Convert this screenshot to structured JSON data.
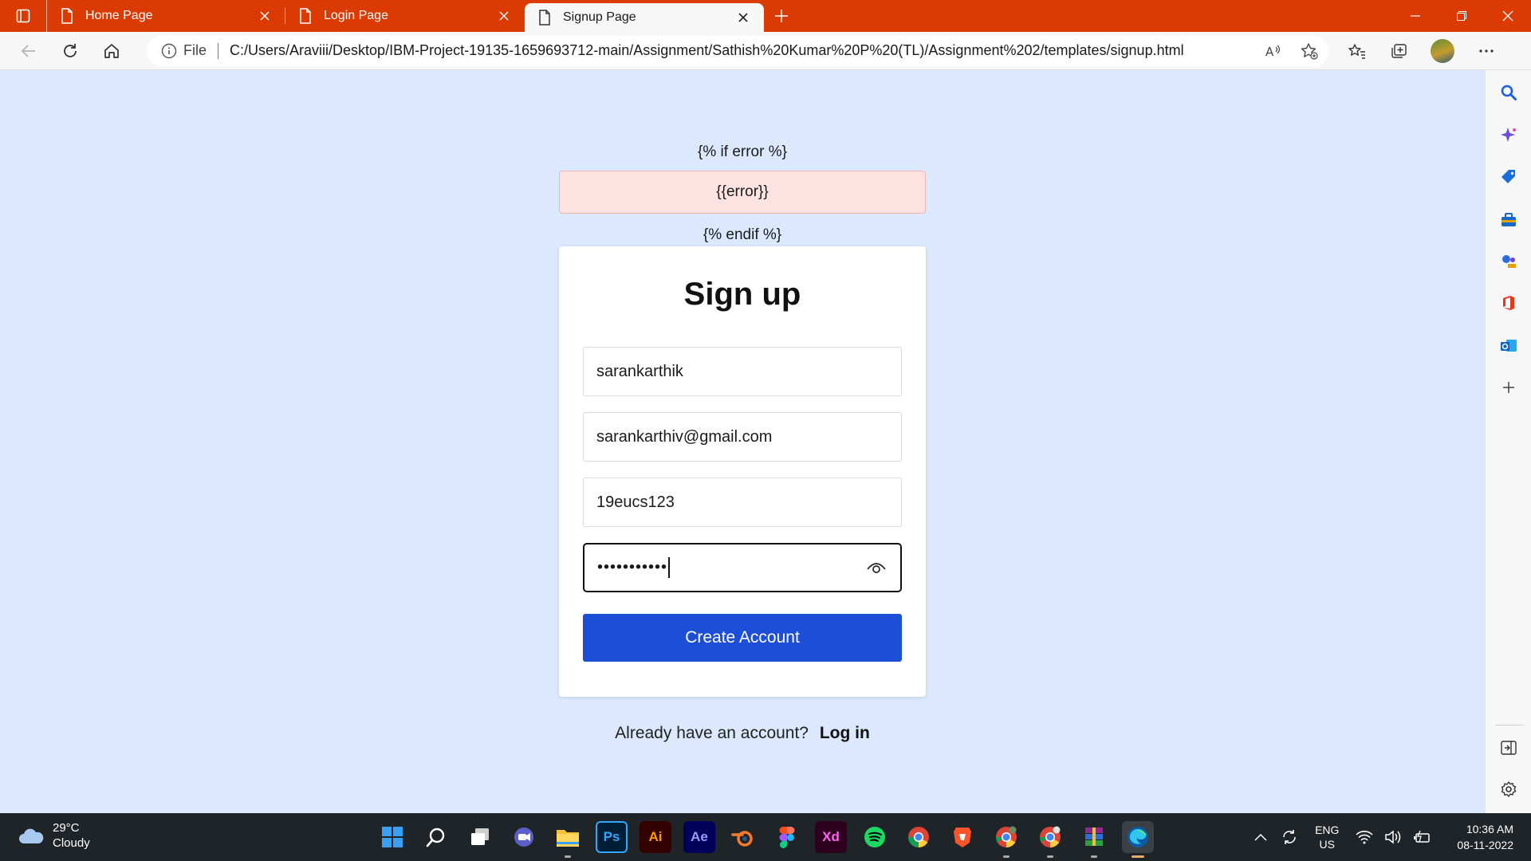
{
  "browser": {
    "tabs": [
      {
        "title": "Home Page",
        "active": false
      },
      {
        "title": "Login Page",
        "active": false
      },
      {
        "title": "Signup Page",
        "active": true
      }
    ],
    "address": {
      "scheme_label": "File",
      "url": "C:/Users/Araviii/Desktop/IBM-Project-19135-1659693712-main/Assignment/Sathish%20Kumar%20P%20(TL)/Assignment%202/templates/signup.html"
    },
    "sidebar_icons": [
      "search-icon",
      "copilot-icon",
      "shopping-tag-icon",
      "tools-icon",
      "games-icon",
      "office-icon",
      "outlook-icon",
      "add-icon",
      "hide-sidebar-icon",
      "settings-icon"
    ]
  },
  "page": {
    "template_if": "{% if error %}",
    "error_text": "{{error}}",
    "template_endif": "{% endif %}",
    "form": {
      "title": "Sign up",
      "username_value": "sarankarthik",
      "email_value": "sarankarthiv@gmail.com",
      "roll_value": "19eucs123",
      "password_masked": "•••••••••••",
      "submit_label": "Create Account"
    },
    "footer": {
      "prompt": "Already have an account?",
      "login_label": "Log in"
    },
    "colors": {
      "background": "#dbe8fd",
      "button": "#1d4ed8",
      "error_bg": "#fde2e2",
      "tabstrip": "#db3b02"
    }
  },
  "taskbar": {
    "weather": {
      "temp": "29°C",
      "condition": "Cloudy"
    },
    "apps": [
      {
        "name": "start-icon",
        "label": ""
      },
      {
        "name": "search-icon",
        "label": ""
      },
      {
        "name": "task-view-icon",
        "label": ""
      },
      {
        "name": "chat-icon",
        "label": ""
      },
      {
        "name": "file-explorer-icon",
        "label": ""
      },
      {
        "name": "photoshop-icon",
        "label": "Ps"
      },
      {
        "name": "illustrator-icon",
        "label": "Ai"
      },
      {
        "name": "after-effects-icon",
        "label": "Ae"
      },
      {
        "name": "blender-icon",
        "label": ""
      },
      {
        "name": "figma-icon",
        "label": ""
      },
      {
        "name": "xd-icon",
        "label": "Xd"
      },
      {
        "name": "spotify-icon",
        "label": ""
      },
      {
        "name": "chrome-icon",
        "label": ""
      },
      {
        "name": "brave-icon",
        "label": ""
      },
      {
        "name": "chrome-profile-icon",
        "label": ""
      },
      {
        "name": "chrome-profile-2-icon",
        "label": ""
      },
      {
        "name": "winrar-icon",
        "label": ""
      },
      {
        "name": "edge-icon",
        "label": ""
      }
    ],
    "language": {
      "line1": "ENG",
      "line2": "US"
    },
    "clock": {
      "time": "10:36 AM",
      "date": "08-11-2022"
    }
  }
}
